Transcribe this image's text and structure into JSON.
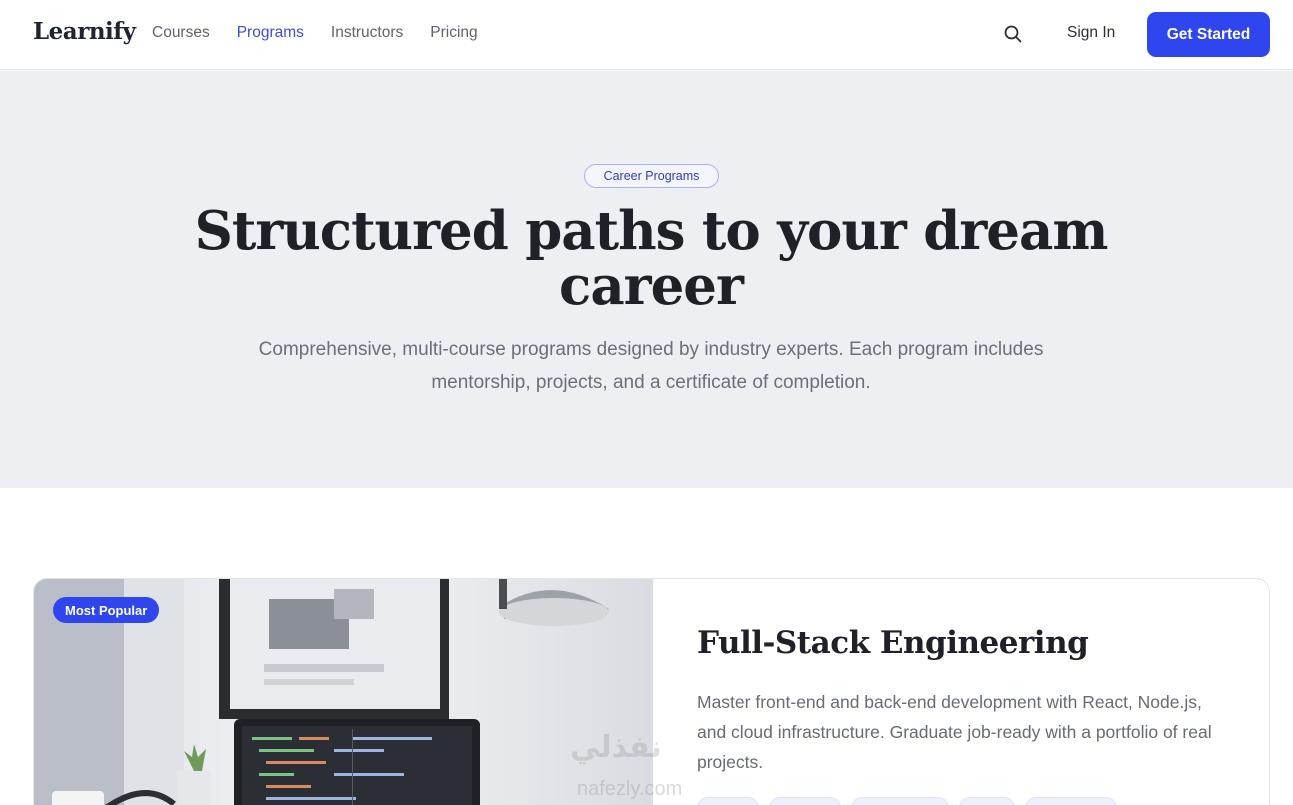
{
  "header": {
    "logo": "Learnify",
    "nav": [
      "Courses",
      "Programs",
      "Instructors",
      "Pricing"
    ],
    "active_nav": "Programs",
    "search_icon": "search-icon",
    "signin_label": "Sign In",
    "cta_label": "Get Started"
  },
  "hero": {
    "pill": "Career Programs",
    "title": "Structured paths to your dream career",
    "subtitle": "Comprehensive, multi-course programs designed by industry experts. Each program includes mentorship, projects, and a certificate of completion."
  },
  "program": {
    "badge": "Most Popular",
    "title": "Full-Stack Engineering",
    "description": "Master front-end and back-end development with React, Node.js, and cloud infrastructure. Graduate job-ready with a portfolio of real projects."
  },
  "watermark": {
    "arabic": "نفذلي",
    "latin": "nafezly.com"
  },
  "colors": {
    "accent": "#2f46ee",
    "hero_bg": "#eeeff3",
    "nav_active": "#3a4fd8"
  }
}
